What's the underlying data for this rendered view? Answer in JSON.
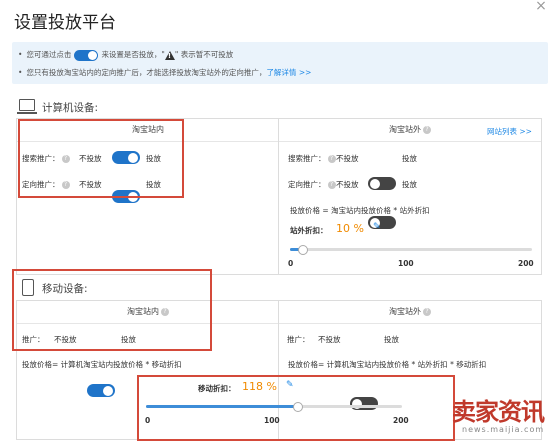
{
  "dialog": {
    "title": "设置投放平台",
    "close": "×"
  },
  "notice": {
    "line1_pre": "您可通过点击",
    "line1_mid": "来设置是否投放，\"",
    "line1_post": "\" 表示暂不可投放",
    "line2": "您只有投放淘宝站内的定向推广后，才能选择投放淘宝站外的定向推广，",
    "line2_link": "了解详情 >>"
  },
  "computer": {
    "title": "计算机设备:",
    "inside": {
      "header": "淘宝站内",
      "rows": [
        {
          "label": "搜索推广：",
          "off": "不投放",
          "on": "投放",
          "state": "on"
        },
        {
          "label": "定向推广：",
          "off": "不投放",
          "on": "投放",
          "state": "on"
        }
      ]
    },
    "outside": {
      "header": "淘宝站外",
      "link": "网站列表 >>",
      "rows": [
        {
          "label": "搜索推广：",
          "off": "不投放",
          "on": "投放",
          "state": "off"
        },
        {
          "label": "定向推广：",
          "off": "不投放",
          "on": "投放",
          "state": "off"
        }
      ],
      "formula": "投放价格 = 淘宝站内投放价格 * 站外折扣",
      "discount_label": "站外折扣：",
      "discount_value": "10 %",
      "slider": {
        "value_percent": 10,
        "ticks": [
          "0",
          "100",
          "200"
        ]
      }
    }
  },
  "mobile": {
    "title": "移动设备:",
    "inside": {
      "header": "淘宝站内",
      "row": {
        "label": "推广：",
        "off": "不投放",
        "on": "投放",
        "state": "on"
      },
      "formula": "投放价格= 计算机淘宝站内投放价格 * 移动折扣"
    },
    "outside": {
      "header": "淘宝站外",
      "row": {
        "label": "推广：",
        "off": "不投放",
        "on": "投放",
        "state": "off"
      },
      "formula": "投放价格= 计算机淘宝站内投放价格 * 站外折扣 * 移动折扣"
    },
    "discount": {
      "label": "移动折扣：",
      "value": "118 %",
      "slider": {
        "value_percent": 118,
        "ticks": [
          "0",
          "100",
          "200"
        ]
      }
    }
  },
  "watermark": {
    "big": "卖家资讯",
    "small": "news.maijia.com"
  },
  "colors": {
    "accent": "#1f74c9",
    "highlight": "#d44a3a",
    "orange": "#f08a00",
    "link": "#1e88e5"
  }
}
